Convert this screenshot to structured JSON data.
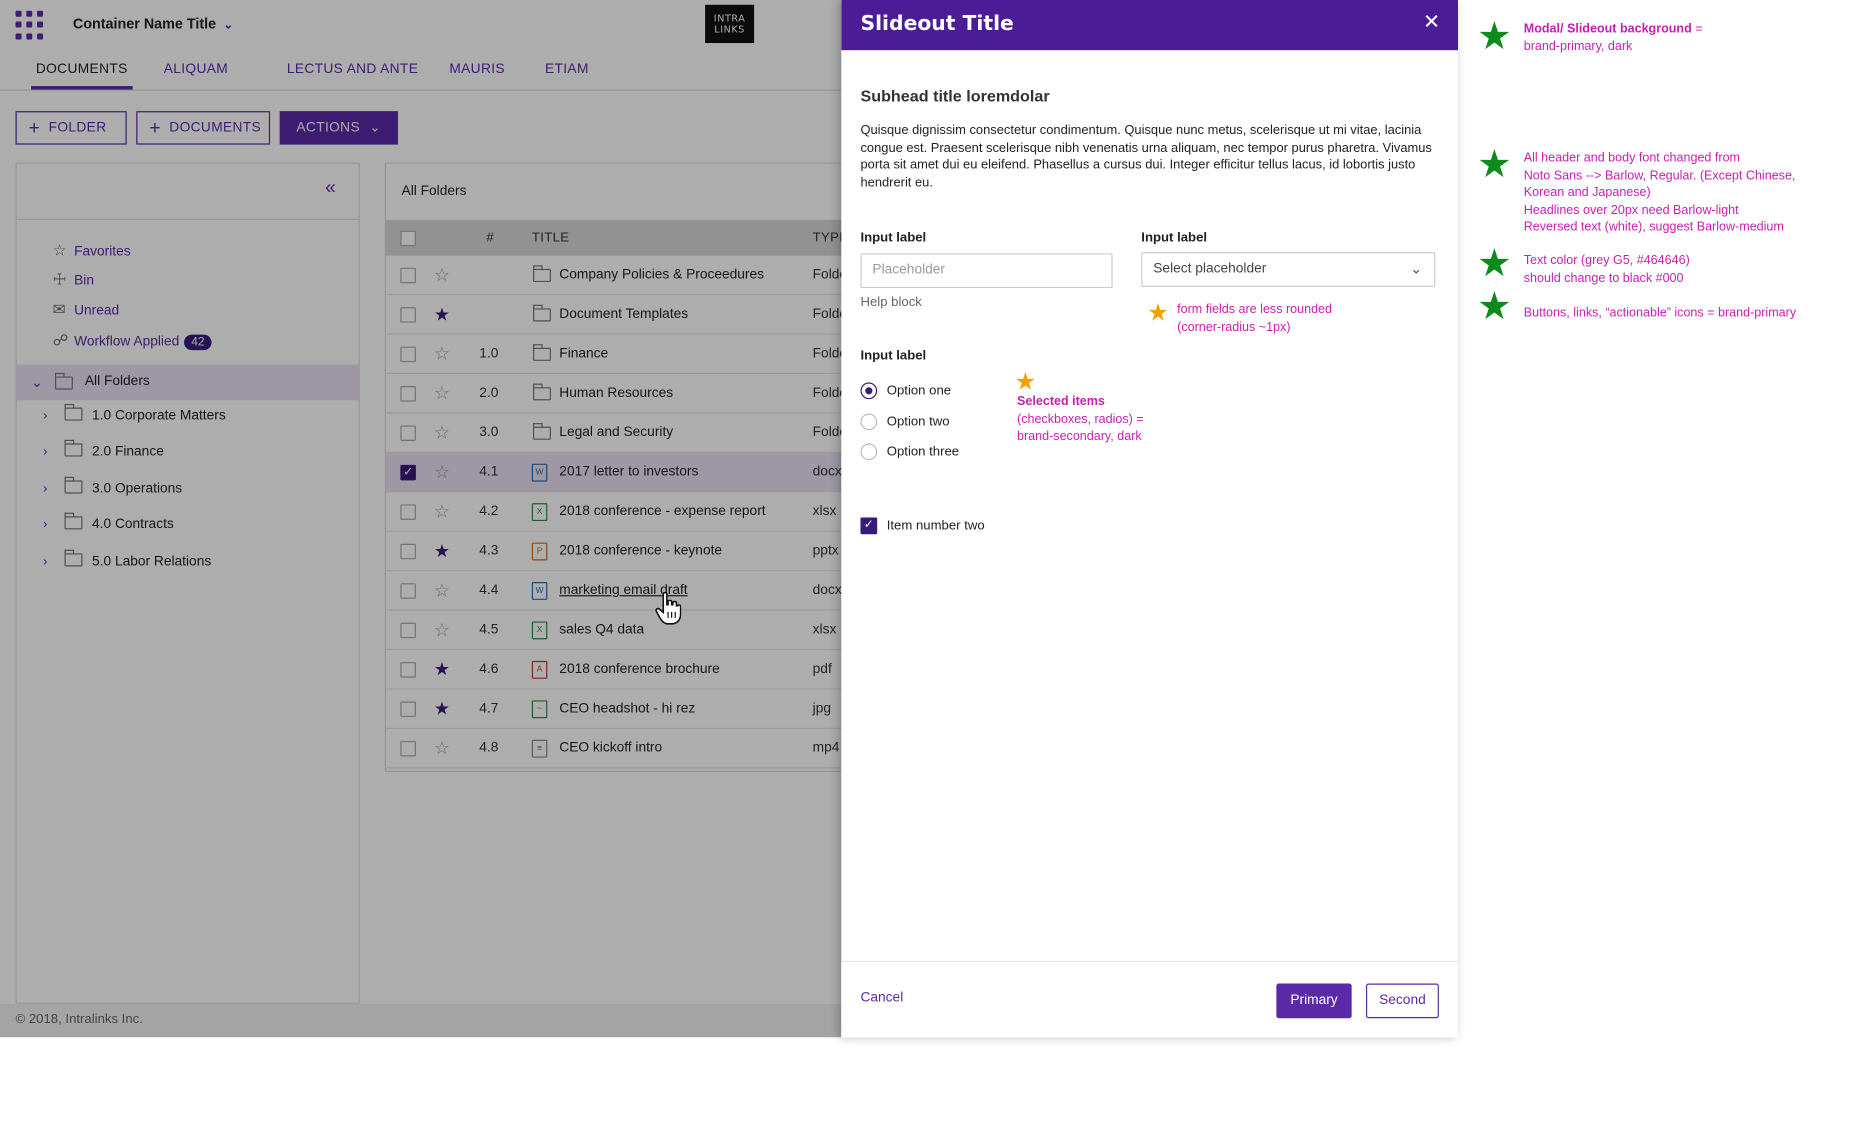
{
  "app": {
    "container_title": "Container Name Title",
    "logo_lines": [
      "INTRA",
      "LINKS"
    ],
    "tabs": [
      "DOCUMENTS",
      "ALIQUAM",
      "LECTUS AND ANTE",
      "MAURIS",
      "ETIAM"
    ],
    "buttons": {
      "folder": "FOLDER",
      "documents": "DOCUMENTS",
      "actions": "ACTIONS"
    },
    "sidebar": {
      "items": [
        {
          "label": "Favorites"
        },
        {
          "label": "Bin"
        },
        {
          "label": "Unread"
        },
        {
          "label": "Workflow Applied",
          "badge": "42"
        }
      ],
      "all_folders": "All Folders",
      "tree": [
        "1.0 Corporate Matters",
        "2.0 Finance",
        "3.0 Operations",
        "4.0 Contracts",
        "5.0 Labor Relations"
      ]
    },
    "grid": {
      "caption": "All Folders",
      "headers": {
        "num": "#",
        "title": "TITLE",
        "type": "TYPE"
      },
      "rows": [
        {
          "num": "",
          "title": "Company Policies & Proceedures",
          "type": "Folde",
          "icon": "folder",
          "starred": false,
          "checked": false
        },
        {
          "num": "",
          "title": "Document Templates",
          "type": "Folde",
          "icon": "folder",
          "starred": true,
          "checked": false
        },
        {
          "num": "1.0",
          "title": "Finance",
          "type": "Folde",
          "icon": "folder",
          "starred": false,
          "checked": false
        },
        {
          "num": "2.0",
          "title": "Human Resources",
          "type": "Folde",
          "icon": "folder",
          "starred": false,
          "checked": false
        },
        {
          "num": "3.0",
          "title": "Legal and Security",
          "type": "Folde",
          "icon": "folder",
          "starred": false,
          "checked": false
        },
        {
          "num": "4.1",
          "title": "2017 letter to investors",
          "type": "docx",
          "icon": "w",
          "starred": false,
          "checked": true
        },
        {
          "num": "4.2",
          "title": "2018 conference - expense report",
          "type": "xlsx",
          "icon": "x",
          "starred": false,
          "checked": false
        },
        {
          "num": "4.3",
          "title": "2018 conference - keynote",
          "type": "pptx",
          "icon": "p",
          "starred": true,
          "checked": false
        },
        {
          "num": "4.4",
          "title": "marketing email draft",
          "type": "docx",
          "icon": "w",
          "starred": false,
          "checked": false,
          "link": true
        },
        {
          "num": "4.5",
          "title": "sales Q4 data",
          "type": "xlsx",
          "icon": "x",
          "starred": false,
          "checked": false
        },
        {
          "num": "4.6",
          "title": "2018 conference brochure",
          "type": "pdf",
          "icon": "pdf",
          "starred": true,
          "checked": false
        },
        {
          "num": "4.7",
          "title": "CEO headshot - hi rez",
          "type": "jpg",
          "icon": "img",
          "starred": true,
          "checked": false
        },
        {
          "num": "4.8",
          "title": "CEO kickoff intro",
          "type": "mp4",
          "icon": "doc",
          "starred": false,
          "checked": false
        }
      ]
    },
    "footer": "© 2018, Intralinks Inc."
  },
  "slideout": {
    "title": "Slideout Title",
    "subhead": "Subhead title loremdolar",
    "paragraph": "Quisque dignissim consectetur condimentum. Quisque nunc metus, scelerisque ut mi vitae, lacinia congue est. Praesent scelerisque nibh venenatis urna aliquam, nec tempor purus pharetra. Vivamus porta sit amet dui eu eleifend. Phasellus a cursus dui. Integer efficitur tellus lacus, id lobortis justo hendrerit eu.",
    "input1": {
      "label": "Input label",
      "placeholder": "Placeholder",
      "help": "Help block"
    },
    "select1": {
      "label": "Input label",
      "value": "Select placeholder"
    },
    "radio_group": {
      "label": "Input label",
      "options": [
        "Option one",
        "Option two",
        "Option three"
      ],
      "selected": 0
    },
    "checkbox": {
      "label": "Item number two",
      "checked": true
    },
    "footer": {
      "cancel": "Cancel",
      "primary": "Primary",
      "second": "Second"
    }
  },
  "annotations": {
    "form_fields": [
      "form fields are less rounded",
      "(corner-radius ~1px)"
    ],
    "selected_items": {
      "title": "Selected items",
      "lines": [
        "(checkboxes, radios) =",
        "brand-secondary, dark"
      ]
    },
    "side_notes": [
      {
        "title": "Modal/ Slideout background",
        "lines": [
          "=",
          "brand-primary, dark"
        ]
      },
      {
        "lines": [
          "All header and body font changed from",
          "Noto Sans --> Barlow, Regular. (Except Chinese,",
          "Korean and Japanese)",
          "Headlines over 20px need Barlow-light",
          "Reversed text (white), suggest Barlow-medium"
        ]
      },
      {
        "lines": [
          "Text color (grey G5, #464646)",
          "should change to black #000"
        ]
      },
      {
        "lines": [
          "Buttons, links, “actionable” icons = brand-primary"
        ]
      }
    ]
  },
  "colors": {
    "brand_primary": "#5b2aa8",
    "brand_primary_dark": "#4a1d96",
    "brand_secondary_dark": "#3a1a78",
    "annotation": "#c81fb2",
    "star_green": "#0c8a1c",
    "star_orange": "#f5a000"
  },
  "icons": [
    "waffle-icon",
    "chevron-down-icon",
    "plus-icon",
    "collapse-left-icon",
    "star-icon",
    "trash-icon",
    "envelope-icon",
    "workflow-icon",
    "folder-icon",
    "chevron-right-icon",
    "word-file-icon",
    "excel-file-icon",
    "powerpoint-file-icon",
    "pdf-file-icon",
    "image-file-icon",
    "document-file-icon",
    "close-icon",
    "hand-cursor-icon"
  ]
}
